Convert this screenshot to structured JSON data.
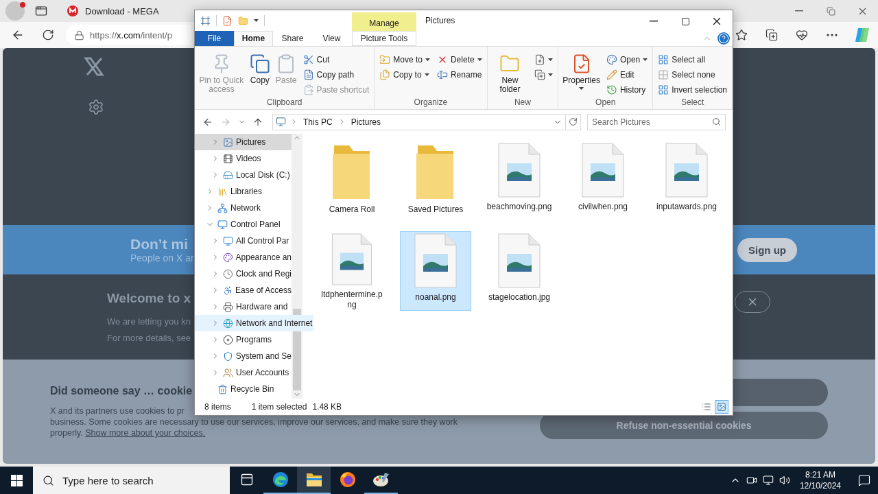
{
  "browser": {
    "tabs": [
      {
        "title": "Download - MEGA",
        "selected": false
      }
    ],
    "address": {
      "scheme": "https://",
      "host": "x.com",
      "path": "/intent/p"
    },
    "page": {
      "banner_title": "Don’t mi",
      "banner_text": "People on X ar",
      "signup": "Sign up",
      "welcome_title": "Welcome to x",
      "welcome_lines": [
        "We are letting you kn",
        "For more details, see"
      ],
      "cookie_title": "Did someone say … cookie",
      "cookie_lines": [
        "X and its partners use cookies to pr",
        "business. Some cookies are necessary to use our services, improve our services, and make sure they work"
      ],
      "cookie_last": "properly.",
      "cookie_link": "Show more about your choices.",
      "refuse": "Refuse non-essential cookies"
    }
  },
  "explorer": {
    "title": "Pictures",
    "context_header": "Manage",
    "tabs": [
      {
        "label": "File",
        "kind": "file",
        "selected": false
      },
      {
        "label": "Home",
        "kind": "normal",
        "selected": true
      },
      {
        "label": "Share",
        "kind": "normal",
        "selected": false
      },
      {
        "label": "View",
        "kind": "normal",
        "selected": false
      },
      {
        "label": "Picture Tools",
        "kind": "context",
        "selected": false
      }
    ],
    "ribbon": {
      "groups": [
        {
          "label": "Clipboard",
          "items": [
            {
              "kind": "large",
              "buttons": [
                {
                  "label": "Pin to Quick access",
                  "disabled": true,
                  "dropdown": false
                }
              ]
            },
            {
              "kind": "large",
              "buttons": [
                {
                  "label": "Copy",
                  "disabled": false,
                  "dropdown": false
                }
              ]
            },
            {
              "kind": "large",
              "buttons": [
                {
                  "label": "Paste",
                  "disabled": true,
                  "dropdown": false
                }
              ]
            },
            {
              "kind": "column",
              "buttons": [
                {
                  "label": "Cut",
                  "disabled": false,
                  "dropdown": false
                },
                {
                  "label": "Copy path",
                  "disabled": false,
                  "dropdown": false
                },
                {
                  "label": "Paste shortcut",
                  "disabled": true,
                  "dropdown": false
                }
              ]
            }
          ]
        },
        {
          "label": "Organize",
          "items": [
            {
              "kind": "column",
              "buttons": [
                {
                  "label": "Move to",
                  "disabled": false,
                  "dropdown": true
                },
                {
                  "label": "Copy to",
                  "disabled": false,
                  "dropdown": true
                }
              ]
            },
            {
              "kind": "column",
              "buttons": [
                {
                  "label": "Delete",
                  "disabled": false,
                  "dropdown": true
                },
                {
                  "label": "Rename",
                  "disabled": false,
                  "dropdown": false
                }
              ]
            }
          ]
        },
        {
          "label": "New",
          "items": [
            {
              "kind": "large",
              "buttons": [
                {
                  "label": "New folder",
                  "disabled": false,
                  "dropdown": false
                }
              ]
            },
            {
              "kind": "column",
              "buttons": [
                {
                  "disabled": false,
                  "dropdown": true
                },
                {
                  "disabled": false,
                  "dropdown": true
                }
              ]
            }
          ]
        },
        {
          "label": "Open",
          "items": [
            {
              "kind": "large",
              "buttons": [
                {
                  "label": "Properties",
                  "disabled": false,
                  "dropdown": true
                }
              ]
            },
            {
              "kind": "column",
              "buttons": [
                {
                  "label": "Open",
                  "disabled": false,
                  "dropdown": true
                },
                {
                  "label": "Edit",
                  "disabled": false,
                  "dropdown": false
                },
                {
                  "label": "History",
                  "disabled": false,
                  "dropdown": false
                }
              ]
            }
          ]
        },
        {
          "label": "Select",
          "items": [
            {
              "kind": "column",
              "buttons": [
                {
                  "label": "Select all",
                  "disabled": false,
                  "dropdown": false
                },
                {
                  "label": "Select none",
                  "disabled": false,
                  "dropdown": false
                },
                {
                  "label": "Invert selection",
                  "disabled": false,
                  "dropdown": false
                }
              ]
            }
          ]
        }
      ]
    },
    "address_bar": {
      "path": [
        "This PC",
        "Pictures"
      ],
      "search_placeholder": "Search Pictures"
    },
    "nav": {
      "items": [
        {
          "children": [
            {
              "label": "Pictures",
              "expanded": false,
              "selected": true,
              "hovered": false
            },
            {
              "label": "Videos",
              "expanded": false,
              "selected": false,
              "hovered": false
            },
            {
              "label": "Local Disk (C:)",
              "expanded": false,
              "selected": false,
              "hovered": false
            }
          ]
        },
        {
          "label": "Libraries",
          "expanded": false,
          "selected": false,
          "hovered": false
        },
        {
          "label": "Network",
          "expanded": false,
          "selected": false,
          "hovered": false
        },
        {
          "label": "Control Panel",
          "expanded": true,
          "selected": false,
          "hovered": false,
          "children": [
            {
              "label": "All Control Par",
              "expanded": false,
              "selected": false,
              "hovered": false
            },
            {
              "label": "Appearance an",
              "expanded": false,
              "selected": false,
              "hovered": false
            },
            {
              "label": "Clock and Regi",
              "expanded": false,
              "selected": false,
              "hovered": false
            },
            {
              "label": "Ease of Access",
              "expanded": false,
              "selected": false,
              "hovered": false
            },
            {
              "label": "Hardware and",
              "expanded": false,
              "selected": false,
              "hovered": false
            },
            {
              "label": "Network and Internet",
              "expanded": false,
              "selected": false,
              "hovered": true
            },
            {
              "label": "Programs",
              "expanded": false,
              "selected": false,
              "hovered": false
            },
            {
              "label": "System and Se",
              "expanded": false,
              "selected": false,
              "hovered": false
            },
            {
              "label": "User Accounts",
              "expanded": false,
              "selected": false,
              "hovered": false
            }
          ]
        },
        {
          "label": "Recycle Bin",
          "selected": false,
          "hovered": false
        }
      ]
    },
    "files": [
      {
        "name": "Camera Roll",
        "kind": "folder",
        "selected": false
      },
      {
        "name": "Saved Pictures",
        "kind": "folder",
        "selected": false
      },
      {
        "name": "beachmoving.png",
        "kind": "image",
        "selected": false
      },
      {
        "name": "civilwhen.png",
        "kind": "image",
        "selected": false
      },
      {
        "name": "inputawards.png",
        "kind": "image",
        "selected": false
      },
      {
        "name": "ltdphentermine.png",
        "kind": "image",
        "selected": false
      },
      {
        "name": "noanal.png",
        "kind": "image",
        "selected": true
      },
      {
        "name": "stagelocation.jpg",
        "kind": "image",
        "selected": false
      }
    ],
    "status": {
      "count": "8 items",
      "selection": "1 item selected",
      "size": "1.48 KB"
    },
    "views": [
      {
        "kind": "details",
        "selected": false
      },
      {
        "kind": "icons",
        "selected": true
      }
    ]
  },
  "taskbar": {
    "search_placeholder": "Type here to search",
    "apps": [
      {
        "kind": "taskview",
        "running": false,
        "selected": false
      },
      {
        "kind": "edge",
        "running": true,
        "selected": false
      },
      {
        "kind": "explorer",
        "running": true,
        "selected": true
      },
      {
        "kind": "firefox",
        "running": false,
        "selected": false
      },
      {
        "kind": "paint",
        "running": true,
        "selected": false
      }
    ],
    "time": "8:21 AM",
    "date": "12/10/2024"
  }
}
